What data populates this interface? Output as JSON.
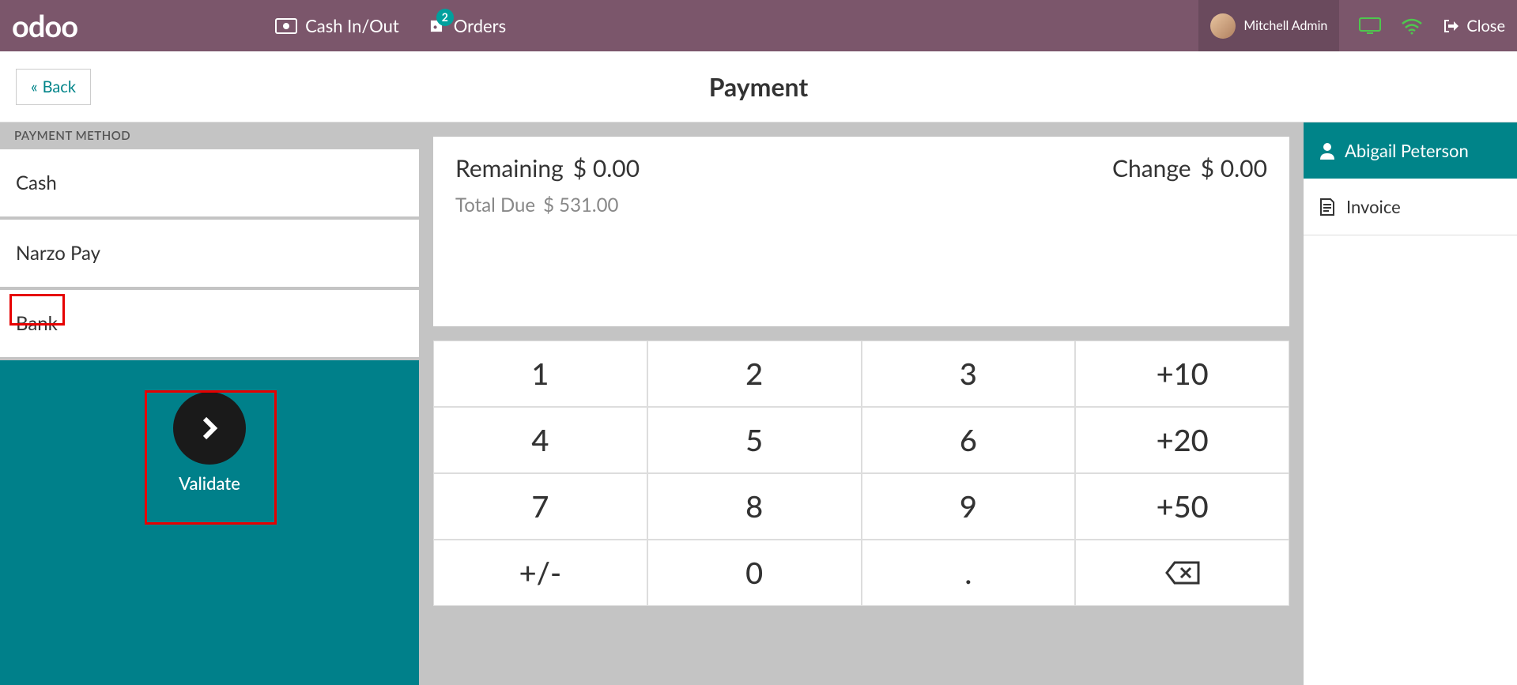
{
  "navbar": {
    "logo": "odoo",
    "cash_label": "Cash In/Out",
    "orders_label": "Orders",
    "orders_badge": "2",
    "user_name": "Mitchell Admin",
    "close_label": "Close"
  },
  "header": {
    "back_label": "Back",
    "title": "Payment"
  },
  "payment_methods": {
    "header": "PAYMENT METHOD",
    "items": [
      "Cash",
      "Narzo Pay",
      "Bank"
    ]
  },
  "validate": {
    "label": "Validate"
  },
  "amounts": {
    "remaining_label": "Remaining",
    "remaining_value": "$ 0.00",
    "change_label": "Change",
    "change_value": "$ 0.00",
    "total_due_label": "Total Due",
    "total_due_value": "$ 531.00"
  },
  "numpad": {
    "rows": [
      [
        "1",
        "2",
        "3",
        "+10"
      ],
      [
        "4",
        "5",
        "6",
        "+20"
      ],
      [
        "7",
        "8",
        "9",
        "+50"
      ],
      [
        "+/-",
        "0",
        ".",
        "⌫"
      ]
    ]
  },
  "customer": {
    "name": "Abigail Peterson",
    "invoice_label": "Invoice"
  }
}
